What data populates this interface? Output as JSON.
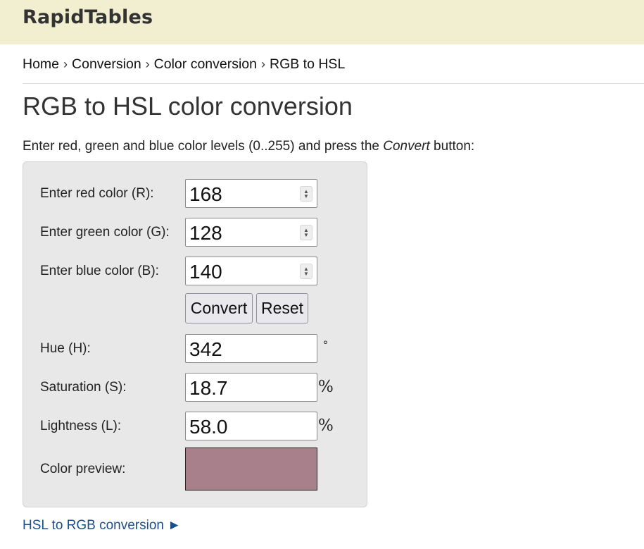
{
  "header": {
    "logo": "RapidTables"
  },
  "breadcrumb": {
    "items": [
      "Home",
      "Conversion",
      "Color conversion",
      "RGB to HSL"
    ],
    "separator": "›"
  },
  "page_title": "RGB to HSL color conversion",
  "intro": {
    "before": "Enter red, green and blue color levels (0..255) and press the ",
    "emphasis": "Convert",
    "after": " button:"
  },
  "form": {
    "red": {
      "label": "Enter red color (R):",
      "value": "168"
    },
    "green": {
      "label": "Enter green color (G):",
      "value": "128"
    },
    "blue": {
      "label": "Enter blue color (B):",
      "value": "140"
    },
    "convert_label": "Convert",
    "reset_label": "Reset",
    "hue": {
      "label": "Hue (H):",
      "value": "342",
      "unit": "°"
    },
    "saturation": {
      "label": "Saturation (S):",
      "value": "18.7",
      "unit": "%"
    },
    "lightness": {
      "label": "Lightness (L):",
      "value": "58.0",
      "unit": "%"
    },
    "preview": {
      "label": "Color preview:",
      "color": "#a8808c"
    }
  },
  "footer_link": "HSL to RGB conversion ►",
  "colors": {
    "header_bg": "#f1efd0",
    "panel_bg": "#e8e8e8",
    "link": "#1a4f8b"
  },
  "icons": {
    "spinner": "up-down-arrows-icon"
  }
}
